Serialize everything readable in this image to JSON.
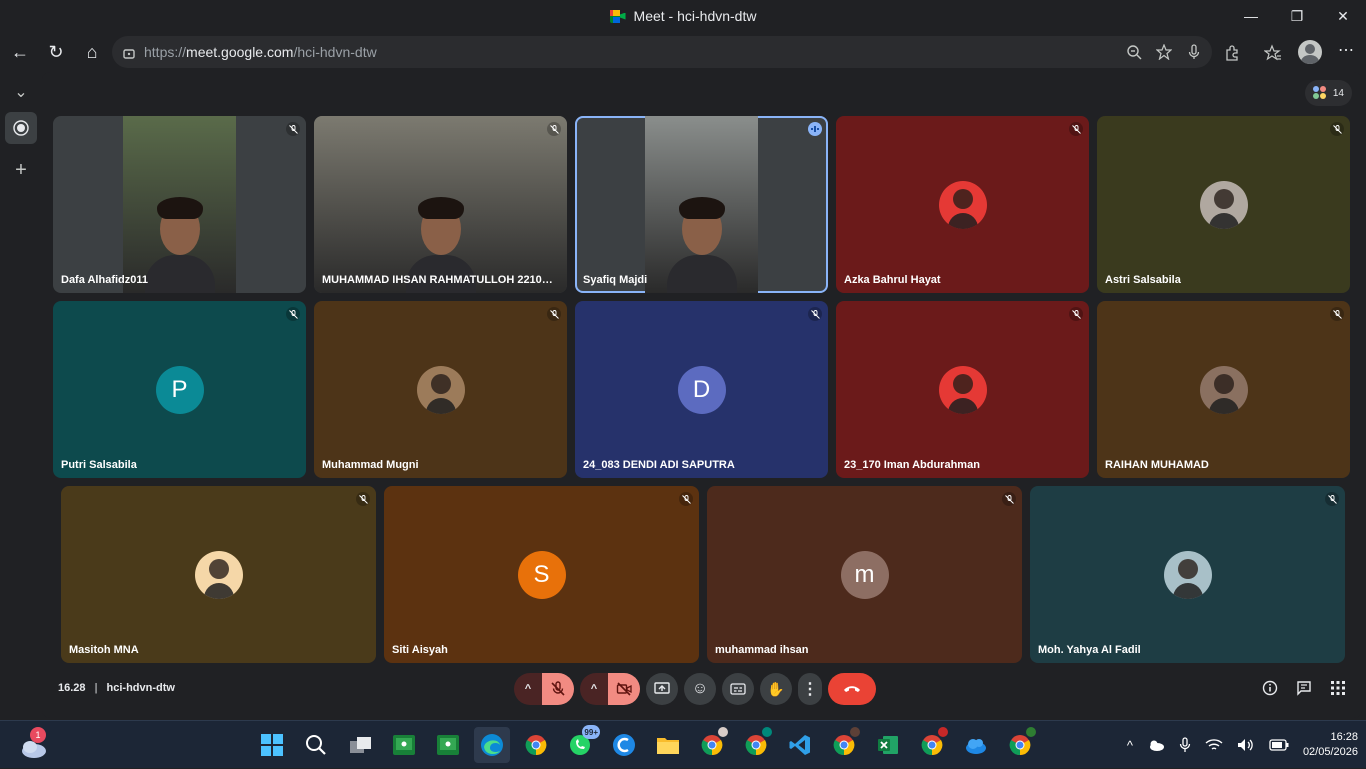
{
  "window": {
    "title": "Meet - hci-hdvn-dtw",
    "minimize": "—",
    "maximize": "❐",
    "close": "✕"
  },
  "browser": {
    "url_prefix": "https://",
    "url_host": "meet.google.com",
    "url_path": "/hci-hdvn-dtw",
    "back": "←",
    "reload": "↻",
    "home": "⌂"
  },
  "meet": {
    "participant_count": "14",
    "time": "16.28",
    "separator": "|",
    "meeting_code": "hci-hdvn-dtw",
    "participants": [
      {
        "name": "Dafa Alhafidz011",
        "type": "video",
        "bg": "#3c4043",
        "video_color": "#5a6b4a",
        "mic": "muted"
      },
      {
        "name": "MUHAMMAD IHSAN RAHMATULLOH 221002...",
        "type": "video",
        "bg": "#3c4043",
        "video_color": "#7c7a70",
        "mic": "muted"
      },
      {
        "name": "Syafiq Majdi",
        "type": "video",
        "bg": "#3c4043",
        "video_color": "#8a8e8c",
        "mic": "speaking",
        "active": true
      },
      {
        "name": "Azka Bahrul Hayat",
        "type": "photo",
        "bg": "#6b1a1a",
        "avatar_color": "#e53935",
        "mic": "muted"
      },
      {
        "name": "Astri Salsabila",
        "type": "photo",
        "bg": "#3a3a1e",
        "avatar_color": "#b0a8a0",
        "mic": "muted"
      },
      {
        "name": "Putri Salsabila",
        "type": "letter",
        "letter": "P",
        "bg": "#0d4a4d",
        "avatar_color": "#0b8a96",
        "mic": "muted"
      },
      {
        "name": "Muhammad Mugni",
        "type": "photo",
        "bg": "#4d3418",
        "avatar_color": "#9c7b5a",
        "mic": "muted"
      },
      {
        "name": "24_083 DENDI ADI SAPUTRA",
        "type": "letter",
        "letter": "D",
        "bg": "#26326b",
        "avatar_color": "#5c6bc0",
        "mic": "muted"
      },
      {
        "name": "23_170 Iman Abdurahman",
        "type": "photo",
        "bg": "#6b1a1a",
        "avatar_color": "#e53935",
        "mic": "muted"
      },
      {
        "name": "RAIHAN MUHAMAD",
        "type": "photo",
        "bg": "#4d3418",
        "avatar_color": "#8a7060",
        "mic": "muted"
      },
      {
        "name": "Masitoh MNA",
        "type": "photo",
        "bg": "#4a3a1a",
        "avatar_color": "#f5d7a8",
        "mic": "muted"
      },
      {
        "name": "Siti Aisyah",
        "type": "letter",
        "letter": "S",
        "bg": "#5c3210",
        "avatar_color": "#e8710a",
        "mic": "muted"
      },
      {
        "name": "muhammad ihsan",
        "type": "letter",
        "letter": "m",
        "bg": "#4d2a1c",
        "avatar_color": "#8d6e63",
        "mic": "muted"
      },
      {
        "name": "Moh. Yahya Al Fadil",
        "type": "photo",
        "bg": "#1e3d44",
        "avatar_color": "#a8c0c8",
        "mic": "muted"
      }
    ]
  },
  "controls": {
    "mic_off": "🎤",
    "cam_off": "🎥",
    "present": "⬆",
    "emoji": "☺",
    "captions": "CC",
    "hand": "✋",
    "more": "⋮",
    "end": "☎",
    "chevron": "^",
    "info": "ⓘ",
    "chat": "💬",
    "activities": "⋮⋮"
  },
  "taskbar": {
    "weather_badge": "1",
    "whatsapp_badge": "99+",
    "clock_time": "16:28",
    "clock_date": "02/05/2026"
  }
}
